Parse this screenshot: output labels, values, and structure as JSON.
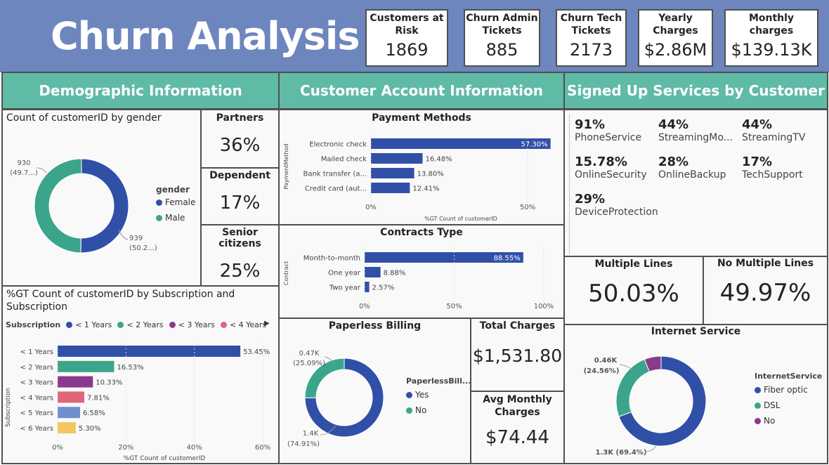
{
  "header": {
    "title": "Churn Analysis"
  },
  "kpis": [
    {
      "label": "Customers at\nRisk",
      "value": "1869"
    },
    {
      "label": "Churn Admin\nTickets",
      "value": "885"
    },
    {
      "label": "Churn Tech\nTickets",
      "value": "2173"
    },
    {
      "label": "Yearly\nCharges",
      "value": "$2.86M"
    },
    {
      "label": "Monthly charges",
      "value": "$139.13K"
    }
  ],
  "sections": {
    "demographic": "Demographic Information",
    "account": "Customer Account Information",
    "services": "Signed Up Services by Customer"
  },
  "gender": {
    "title": "Count of customerID by gender",
    "legend_title": "gender",
    "legend": [
      "Female",
      "Male"
    ],
    "label_male_value": "930",
    "label_male_pct": "(49.7...)",
    "label_female_value": "939",
    "label_female_pct": "(50.2...)"
  },
  "partners": {
    "label": "Partners",
    "value": "36%"
  },
  "dependent": {
    "label": "Dependent",
    "value": "17%"
  },
  "senior": {
    "label": "Senior citizens",
    "value": "25%"
  },
  "payment": {
    "title": "Payment Methods",
    "ylabel": "PaymentMethod",
    "xlabel": "%GT Count of customerID",
    "ticks": [
      "0%",
      "50%"
    ]
  },
  "contracts": {
    "title": "Contracts Type",
    "ylabel": "Contract",
    "ticks": [
      "0%",
      "50%",
      "100%"
    ]
  },
  "subscription": {
    "title": "%GT Count of customerID by Subscription and Subscription",
    "legend_title": "Subscription",
    "legend": [
      "< 1 Years",
      "< 2 Years",
      "< 3 Years",
      "< 4 Years"
    ],
    "ylabel": "Subscription",
    "xlabel": "%GT Count of customerID",
    "ticks": [
      "0%",
      "20%",
      "40%",
      "60%"
    ],
    "nav_icon": "triangle-right-icon"
  },
  "paperless": {
    "title": "Paperless Billing",
    "legend_title": "PaperlessBill...",
    "legend": [
      "Yes",
      "No"
    ],
    "label_no_value": "0.47K",
    "label_no_pct": "(25.09%)",
    "label_yes_value": "1.4K",
    "label_yes_pct": "(74.91%)"
  },
  "total_charges": {
    "label": "Total Charges",
    "value": "$1,531.80"
  },
  "avg_monthly": {
    "label": "Avg Monthly\nCharges",
    "value": "$74.44"
  },
  "services": [
    {
      "pct": "91%",
      "label": "PhoneService"
    },
    {
      "pct": "44%",
      "label": "StreamingMo..."
    },
    {
      "pct": "44%",
      "label": "StreamingTV"
    },
    {
      "pct": "15.78%",
      "label": "OnlineSecurity"
    },
    {
      "pct": "28%",
      "label": "OnlineBackup"
    },
    {
      "pct": "17%",
      "label": "TechSupport"
    },
    {
      "pct": "29%",
      "label": "DeviceProtection"
    }
  ],
  "multiple_lines": {
    "label": "Multiple Lines",
    "value": "50.03%"
  },
  "no_multiple_lines": {
    "label": "No Multiple Lines",
    "value": "49.97%"
  },
  "internet": {
    "title": "Internet Service",
    "legend_title": "InternetService",
    "legend": [
      "Fiber optic",
      "DSL",
      "No"
    ],
    "label_dsl": "0.46K",
    "label_dsl_pct": "(24.56%)",
    "label_fiber": "1.3K (69.4%)"
  },
  "colors": {
    "header_bg": "#6d86bd",
    "section_bg": "#5fbba5",
    "blue": "#3050a8",
    "teal": "#3aa58a",
    "purple": "#8a3a8c",
    "pink": "#e0667a",
    "lightblue": "#6f8fd0",
    "yellow": "#f2c760"
  },
  "chart_data": [
    {
      "type": "pie",
      "name": "gender",
      "categories": [
        "Female",
        "Male"
      ],
      "values": [
        939,
        930
      ]
    },
    {
      "type": "bar",
      "orientation": "horizontal",
      "title": "Payment Methods",
      "xlabel": "%GT Count of customerID",
      "ylabel": "PaymentMethod",
      "categories": [
        "Electronic check",
        "Mailed check",
        "Bank transfer (a...",
        "Credit card (aut..."
      ],
      "values": [
        57.3,
        16.48,
        13.8,
        12.41
      ],
      "labels": [
        "57.30%",
        "16.48%",
        "13.80%",
        "12.41%"
      ],
      "xlim": [
        0,
        65
      ]
    },
    {
      "type": "bar",
      "orientation": "horizontal",
      "title": "Contracts Type",
      "ylabel": "Contract",
      "categories": [
        "Month-to-month",
        "One year",
        "Two year"
      ],
      "values": [
        88.55,
        8.88,
        2.57
      ],
      "labels": [
        "88.55%",
        "8.88%",
        "2.57%"
      ],
      "xlim": [
        0,
        100
      ]
    },
    {
      "type": "bar",
      "orientation": "horizontal",
      "title": "%GT Count of customerID by Subscription and Subscription",
      "xlabel": "%GT Count of customerID",
      "ylabel": "Subscription",
      "categories": [
        "< 1 Years",
        "< 2 Years",
        "< 3 Years",
        "< 4 Years",
        "< 5 Years",
        "< 6 Years"
      ],
      "values": [
        53.45,
        16.53,
        10.33,
        7.81,
        6.58,
        5.3
      ],
      "labels": [
        "53.45%",
        "16.53%",
        "10.33%",
        "7.81%",
        "6.58%",
        "5.30%"
      ],
      "colors": [
        "#3050a8",
        "#3aa58a",
        "#8a3a8c",
        "#e0667a",
        "#6f8fd0",
        "#f2c760"
      ],
      "xlim": [
        0,
        60
      ]
    },
    {
      "type": "pie",
      "name": "PaperlessBilling",
      "categories": [
        "Yes",
        "No"
      ],
      "values": [
        74.91,
        25.09
      ]
    },
    {
      "type": "pie",
      "name": "InternetService",
      "categories": [
        "Fiber optic",
        "DSL",
        "No"
      ],
      "values": [
        69.4,
        24.56,
        6.04
      ]
    }
  ]
}
